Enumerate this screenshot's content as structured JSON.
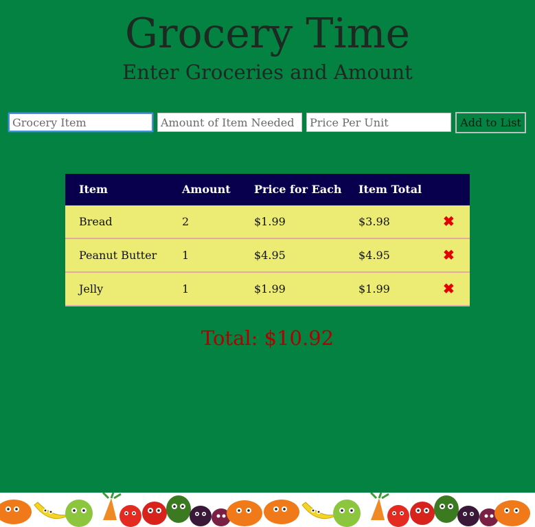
{
  "header": {
    "title": "Grocery Time",
    "subtitle": "Enter Groceries and Amount"
  },
  "form": {
    "item_placeholder": "Grocery Item",
    "amount_placeholder": "Amount of Item Needed",
    "price_placeholder": "Price Per Unit",
    "add_label": "Add to List"
  },
  "table": {
    "headers": [
      "Item",
      "Amount",
      "Price for Each",
      "Item Total"
    ],
    "rows": [
      {
        "item": "Bread",
        "amount": "2",
        "price": "$1.99",
        "total": "$3.98",
        "delete_icon": "✖"
      },
      {
        "item": "Peanut Butter",
        "amount": "1",
        "price": "$4.95",
        "total": "$4.95",
        "delete_icon": "✖"
      },
      {
        "item": "Jelly",
        "amount": "1",
        "price": "$1.99",
        "total": "$1.99",
        "delete_icon": "✖"
      }
    ]
  },
  "summary": {
    "total": "Total: $10.92"
  },
  "colors": {
    "background": "#048242",
    "table_header": "#08004d",
    "row": "#ecec74",
    "delete": "#e40000",
    "total_text": "#b00000"
  },
  "footer": {
    "decoration": "cartoon-vegetables-banner"
  }
}
